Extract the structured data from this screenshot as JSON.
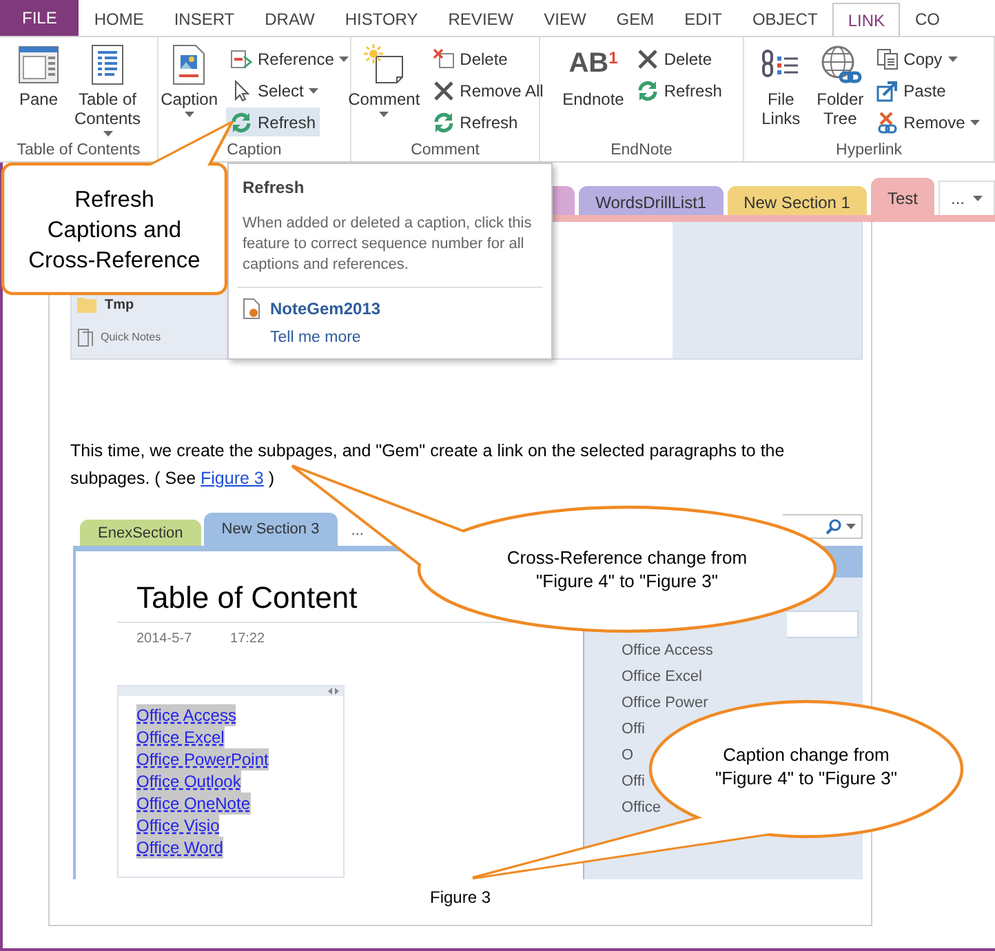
{
  "menu_tabs": [
    {
      "label": "FILE",
      "kind": "file",
      "selected": false
    },
    {
      "label": "HOME",
      "kind": "tab",
      "selected": false
    },
    {
      "label": "INSERT",
      "kind": "tab",
      "selected": false
    },
    {
      "label": "DRAW",
      "kind": "tab",
      "selected": false
    },
    {
      "label": "HISTORY",
      "kind": "tab",
      "selected": false
    },
    {
      "label": "REVIEW",
      "kind": "tab",
      "selected": false
    },
    {
      "label": "VIEW",
      "kind": "tab",
      "selected": false
    },
    {
      "label": "GEM",
      "kind": "tab",
      "selected": false
    },
    {
      "label": "EDIT",
      "kind": "tab",
      "selected": false
    },
    {
      "label": "OBJECT",
      "kind": "tab",
      "selected": false
    },
    {
      "label": "LINK",
      "kind": "tab",
      "selected": true
    },
    {
      "label": "CO",
      "kind": "tab",
      "selected": false
    }
  ],
  "ribbon_groups": [
    {
      "title": "Table of Contents",
      "items": [
        {
          "kind": "large",
          "label": "Pane",
          "dropdown": false,
          "hovered": false
        },
        {
          "kind": "large",
          "label": "Table of\nContents",
          "dropdown": true,
          "hovered": false
        }
      ]
    },
    {
      "title": "Caption",
      "items": [
        {
          "kind": "large",
          "label": "Caption",
          "dropdown": true,
          "hovered": false
        },
        {
          "kind": "small",
          "label": "Reference",
          "dropdown": true,
          "hovered": false
        },
        {
          "kind": "small",
          "label": "Select",
          "dropdown": true,
          "hovered": false
        },
        {
          "kind": "small",
          "label": "Refresh",
          "dropdown": false,
          "hovered": true
        }
      ]
    },
    {
      "title": "Comment",
      "items": [
        {
          "kind": "large",
          "label": "Comment",
          "dropdown": true,
          "hovered": false
        },
        {
          "kind": "small",
          "label": "Delete",
          "dropdown": false,
          "hovered": false
        },
        {
          "kind": "small",
          "label": "Remove All",
          "dropdown": false,
          "hovered": false
        },
        {
          "kind": "small",
          "label": "Refresh",
          "dropdown": false,
          "hovered": false
        }
      ]
    },
    {
      "title": "EndNote",
      "items": [
        {
          "kind": "large",
          "label": "Endnote",
          "glyph": "AB$^{1}$",
          "dropdown": false,
          "hovered": false
        },
        {
          "kind": "small",
          "label": "Delete",
          "dropdown": false,
          "hovered": false
        },
        {
          "kind": "small",
          "label": "Refresh",
          "dropdown": false,
          "hovered": false
        }
      ]
    },
    {
      "title": "Hyperlink",
      "items": [
        {
          "kind": "large",
          "label": "File\nLinks",
          "dropdown": false,
          "hovered": false
        },
        {
          "kind": "large",
          "label": "Folder\nTree",
          "dropdown": false,
          "hovered": false
        },
        {
          "kind": "small",
          "label": "Copy",
          "dropdown": true,
          "hovered": false
        },
        {
          "kind": "small",
          "label": "Paste",
          "dropdown": false,
          "hovered": false
        },
        {
          "kind": "small",
          "label": "Remove",
          "dropdown": true,
          "hovered": false
        }
      ]
    }
  ],
  "section_tabs": [
    {
      "color": "#d6a8d6",
      "selected": false
    },
    {
      "label": "WordsDrillList1",
      "color": "#b6aee0",
      "selected": false
    },
    {
      "label": "New Section 1",
      "color": "#f1d27b",
      "selected": false
    },
    {
      "label": "Test",
      "color": "#f0b2b2",
      "selected": true
    }
  ],
  "section_overflow": "...",
  "figure_top": {
    "folder": "Tmp",
    "quick_notes": "Quick Notes"
  },
  "paragraph": {
    "text": "This time, we create the subpages, and \"Gem\" create a link on the selected paragraphs to the subpages. ( See ",
    "link": "Figure 3",
    "after": " )"
  },
  "figure": {
    "section_tabs": [
      {
        "label": "EnexSection",
        "color": "#c4d98c",
        "selected": false
      },
      {
        "label": "New Section 3",
        "color": "#9dbde3",
        "selected": true
      }
    ],
    "overflow": "...",
    "title": "Table of Content",
    "date": "2014-5-7",
    "time": "17:22",
    "links": [
      "Office Access",
      "Office Excel",
      "Office PowerPoint",
      "Office Outlook",
      "Office OneNote",
      "Office Visio",
      "Office Word"
    ],
    "page_list": [
      "Office Access",
      "Office Excel",
      "Office Power",
      "Offi",
      "O",
      "Offi",
      "Office"
    ]
  },
  "caption": "Figure 3",
  "tooltip": {
    "title": "Refresh",
    "description": "When added or deleted a caption, click this feature to correct sequence number for all captions and references.",
    "addin": "NoteGem2013",
    "link": "Tell me more"
  },
  "callouts": [
    {
      "kind": "box",
      "text": "Refresh\nCaptions and\nCross-Reference"
    },
    {
      "kind": "ellipse",
      "text": "Cross-Reference change from\n\"Figure 4\" to \"Figure 3\""
    },
    {
      "kind": "ellipse",
      "text": "Caption change from\n\"Figure 4\" to \"Figure 3\""
    }
  ]
}
